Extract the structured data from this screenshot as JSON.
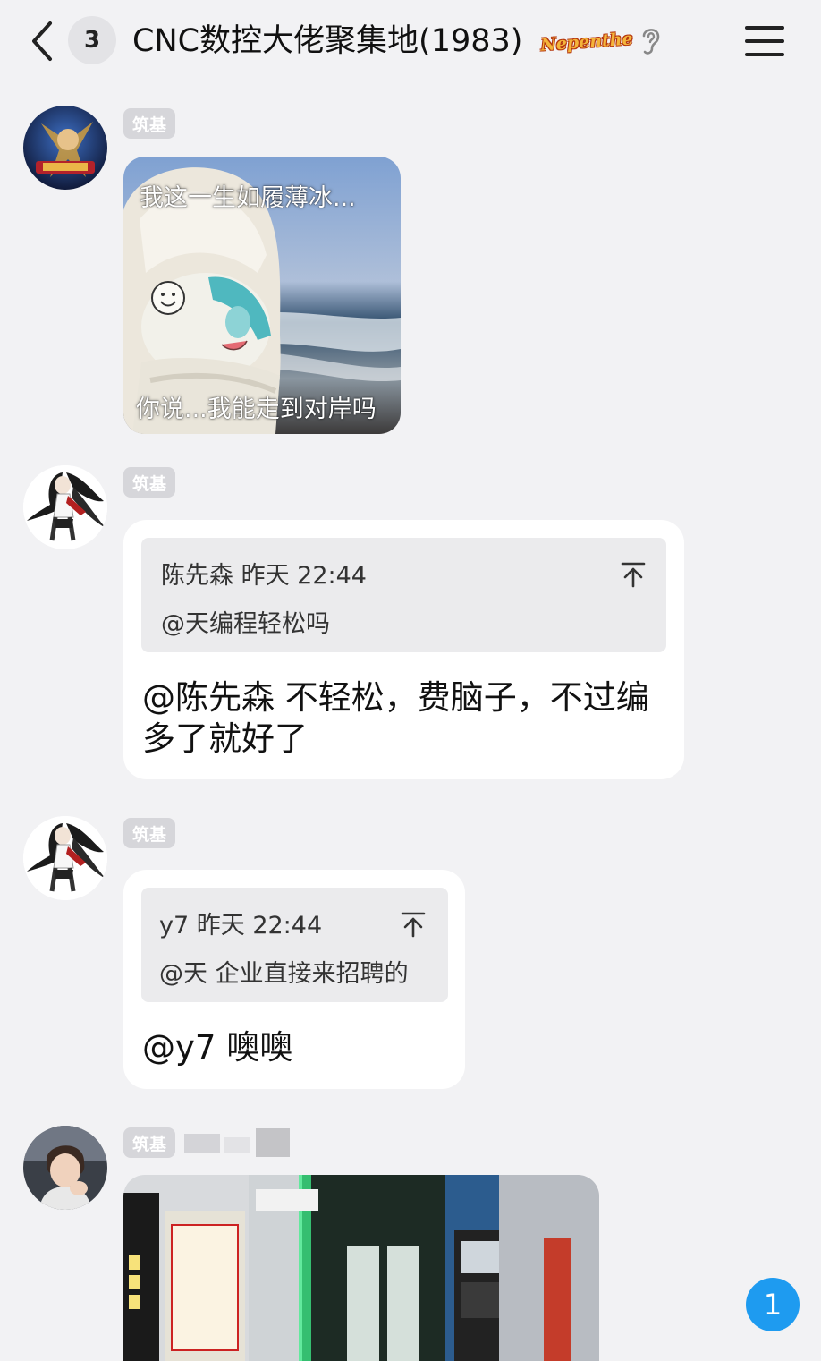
{
  "header": {
    "unread_count": "3",
    "group_title": "CNC数控大佬聚集地(1983)",
    "group_tag": "Nepenthe"
  },
  "messages": [
    {
      "rank": "筑基",
      "sticker": {
        "caption_top": "我这一生如履薄冰...",
        "caption_bottom": "你说...我能走到对岸吗"
      }
    },
    {
      "rank": "筑基",
      "quote": {
        "meta": "陈先森 昨天 22:44",
        "text": "@天编程轻松吗"
      },
      "reply": "@陈先森 不轻松，费脑子，不过编多了就好了"
    },
    {
      "rank": "筑基",
      "quote": {
        "meta": "y7 昨天 22:44",
        "text": "@天 企业直接来招聘的"
      },
      "reply": "@y7 噢噢"
    },
    {
      "rank": "筑基"
    }
  ],
  "new_message_count": "1",
  "colors": {
    "background": "#f2f2f4",
    "bubble": "#ffffff",
    "quote_background": "#ebebed",
    "rank_badge": "#d6d6da",
    "new_message_badge": "#1e9bf0"
  },
  "icons": [
    "chevron-left-icon",
    "ear-icon",
    "menu-icon",
    "jump-to-quote-icon"
  ]
}
